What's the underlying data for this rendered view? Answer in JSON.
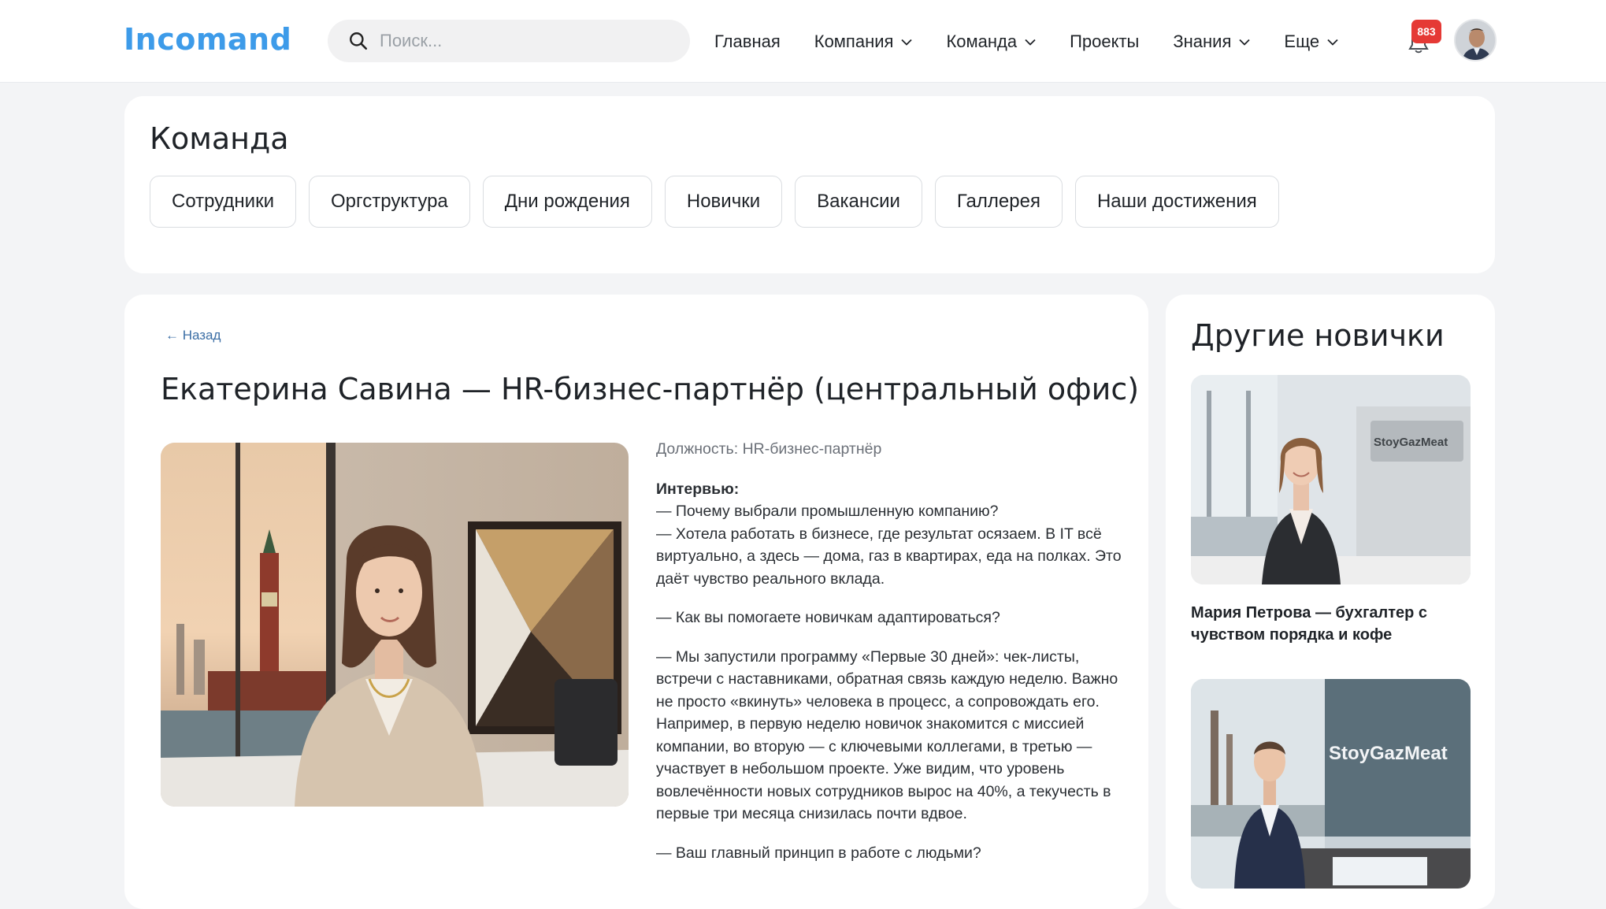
{
  "header": {
    "logo": "Incomand",
    "search_placeholder": "Поиск...",
    "nav": [
      {
        "label": "Главная",
        "has_dropdown": false
      },
      {
        "label": "Компания",
        "has_dropdown": true
      },
      {
        "label": "Команда",
        "has_dropdown": true
      },
      {
        "label": "Проекты",
        "has_dropdown": false
      },
      {
        "label": "Знания",
        "has_dropdown": true
      },
      {
        "label": "Еще",
        "has_dropdown": true
      }
    ],
    "notifications_count": "883"
  },
  "team": {
    "title": "Команда",
    "tabs": [
      "Сотрудники",
      "Оргструктура",
      "Дни рождения",
      "Новички",
      "Вакансии",
      "Галлерея",
      "Наши достижения"
    ]
  },
  "article": {
    "back_label": "← Назад",
    "title": "Екатерина Савина — HR-бизнес-партнёр (центральный офис)",
    "position_label": "Должность:",
    "position_value": "HR-бизнес-партнёр",
    "interview_label": "Интервью:",
    "paragraphs": [
      "— Почему выбрали промышленную компанию?\n— Хотела работать в бизнесе, где результат осязаем. В IT всё виртуально, а здесь — дома, газ в квартирах, еда на полках. Это даёт чувство реального вклада.",
      "— Как вы помогаете новичкам адаптироваться?",
      "— Мы запустили программу «Первые 30 дней»: чек-листы, встречи с наставниками, обратная связь каждую неделю. Важно не просто «вкинуть» человека в процесс, а сопровождать его. Например, в первую неделю новичок знакомится с миссией компании, во вторую — с ключевыми коллегами, в третью — участвует в небольшом проекте. Уже видим, что уровень вовлечённости новых сотрудников вырос на 40%, а текучесть в первые три месяца снизилась почти вдвое.",
      "— Ваш главный принцип в работе с людьми?"
    ]
  },
  "sidebar": {
    "title": "Другие новички",
    "items": [
      {
        "caption": "Мария Петрова — бухгалтер с чувством порядка и кофе",
        "sign_text": "StoyGazMeat"
      },
      {
        "caption": "",
        "sign_text": "StoyGazMeat"
      }
    ]
  },
  "colors": {
    "brand": "#3d9be9",
    "badge": "#e53935",
    "link": "#3b6ea5"
  }
}
